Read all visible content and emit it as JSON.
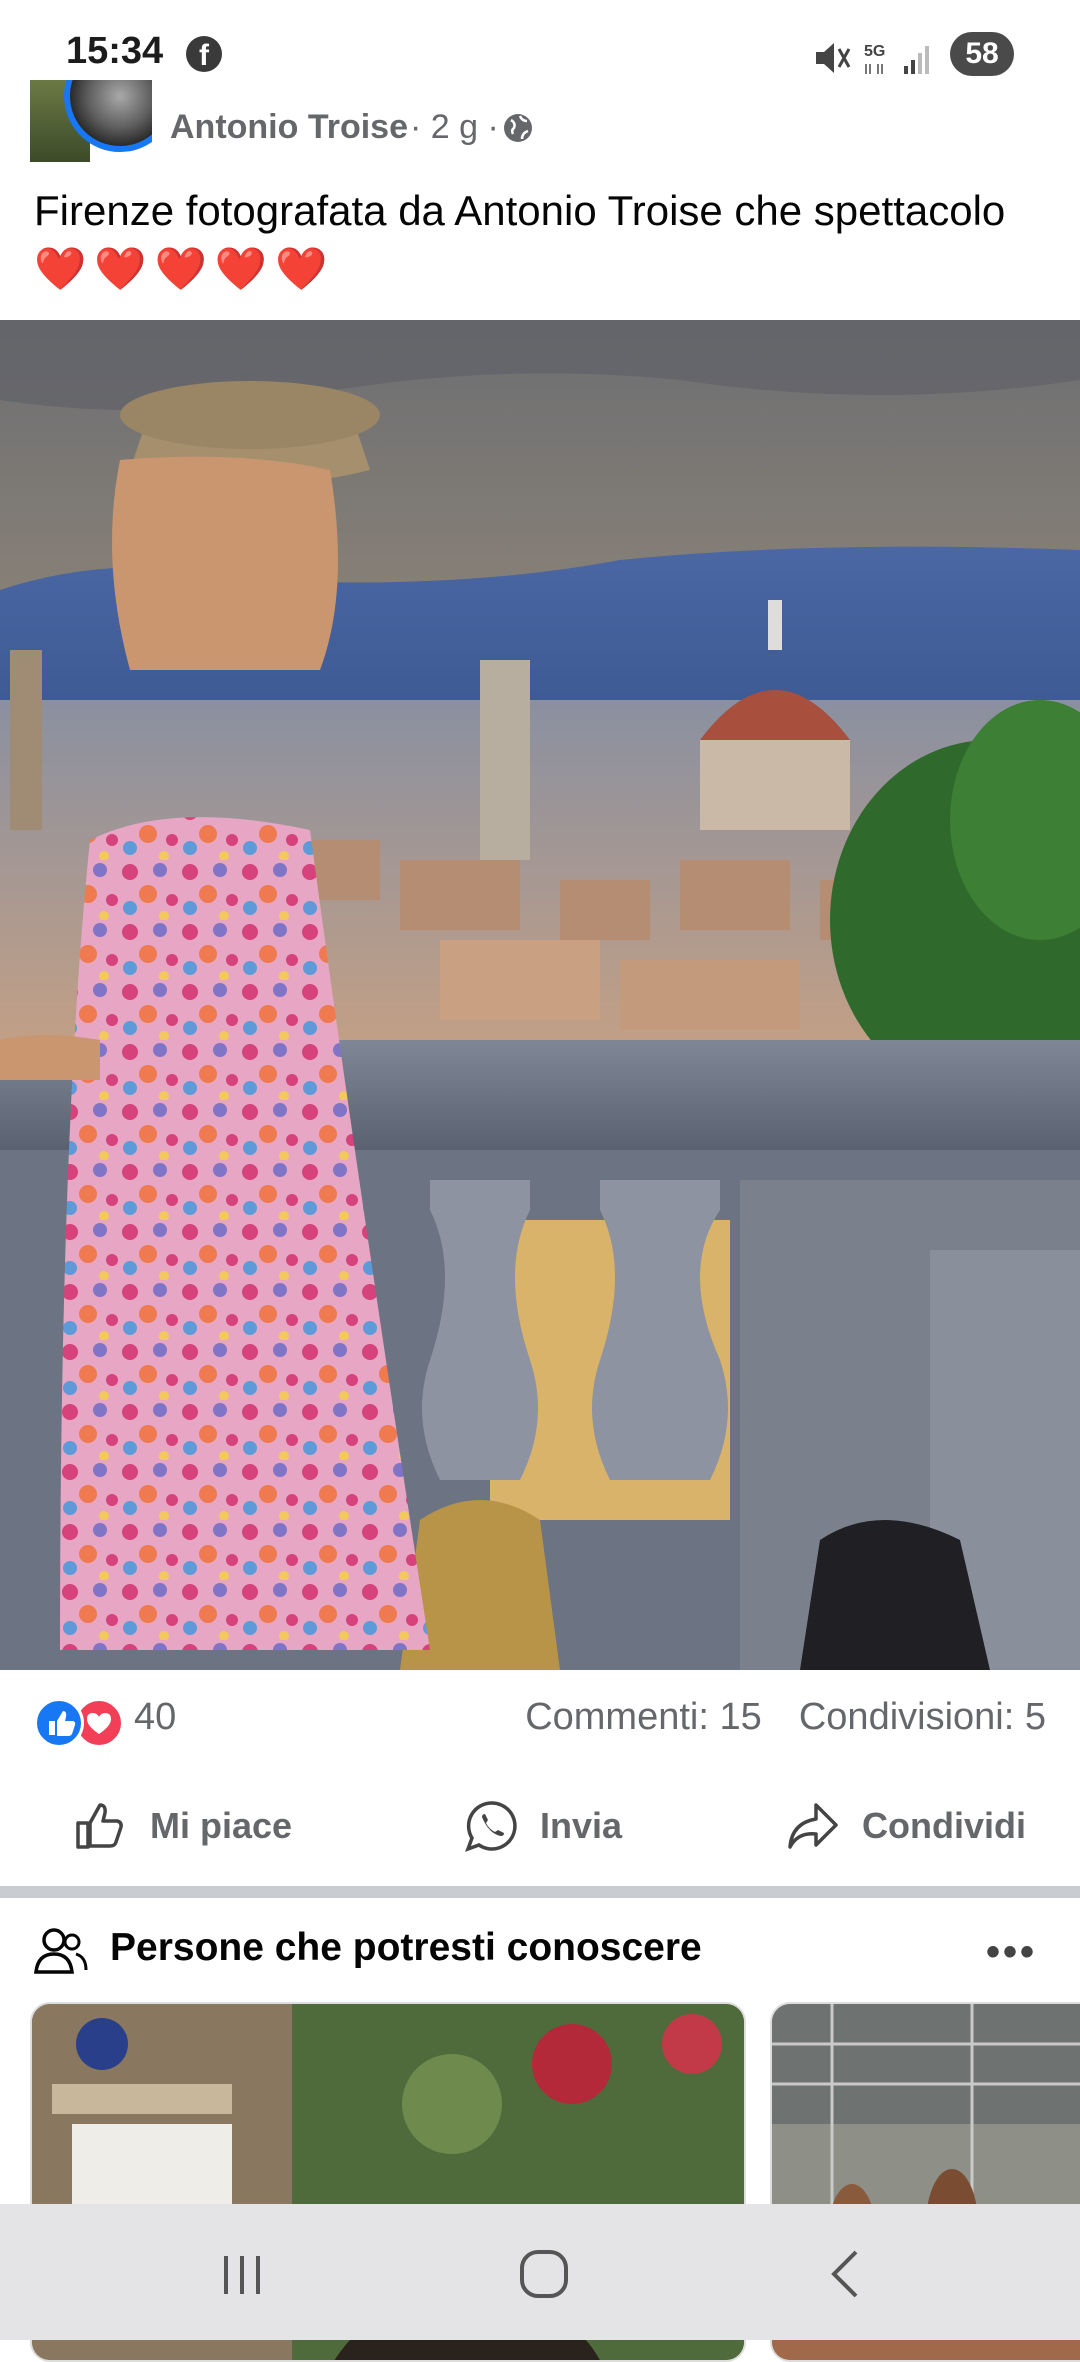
{
  "status": {
    "time": "15:34",
    "battery": "58",
    "network": "5G"
  },
  "post": {
    "author": "Antonio Troise",
    "meta": "· 2 g ·",
    "text": "Firenze fotografata da Antonio Troise che spettacolo",
    "hearts": "❤️❤️❤️❤️❤️"
  },
  "reactions": {
    "count": "40",
    "comments": "Commenti: 15",
    "shares": "Condivisioni: 5"
  },
  "actions": {
    "like": "Mi piace",
    "send": "Invia",
    "share": "Condividi"
  },
  "pymk": {
    "title": "Persone che potresti conoscere"
  },
  "colors": {
    "facebook_blue": "#1877f2",
    "love_red": "#f33e58",
    "text_gray": "#65676b"
  }
}
